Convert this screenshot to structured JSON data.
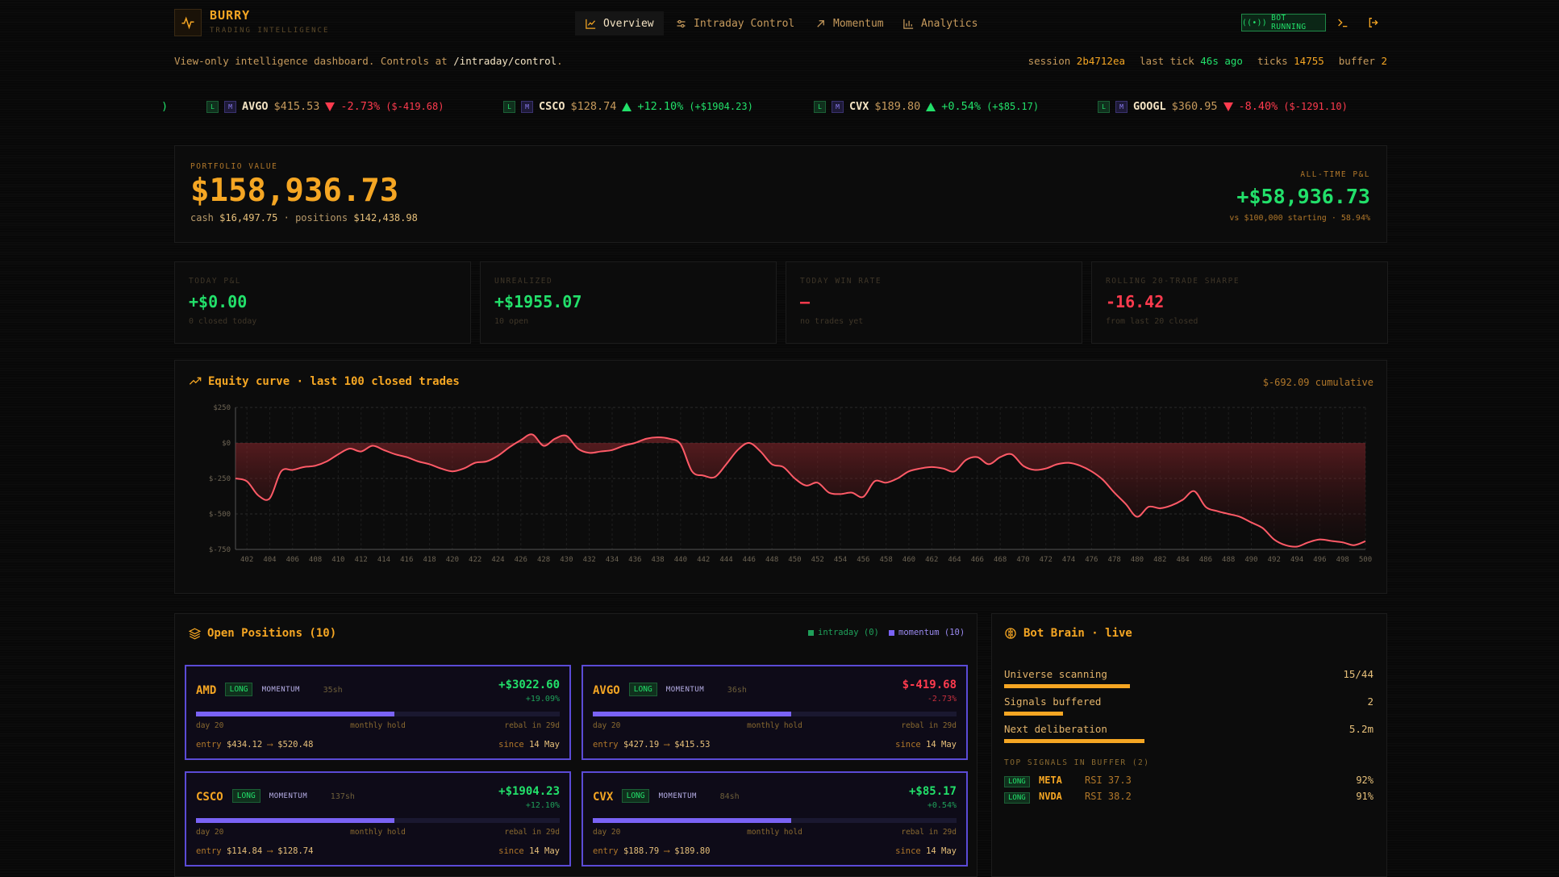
{
  "brand": {
    "name": "BURRY",
    "subtitle": "TRADING INTELLIGENCE"
  },
  "nav": {
    "overview": "Overview",
    "intraday": "Intraday Control",
    "momentum": "Momentum",
    "analytics": "Analytics",
    "active": "Overview"
  },
  "status": {
    "bot": "BOT RUNNING"
  },
  "subline": {
    "prefix": "View-only intelligence dashboard. Controls at ",
    "link": "/intraday/control",
    "suffix": "."
  },
  "session": {
    "session_label": "session",
    "session_value": "2b4712ea",
    "tick_label": "last tick",
    "tick_value": "46s ago",
    "ticks_label": "ticks",
    "ticks_value": "14755",
    "buffer_label": "buffer",
    "buffer_value": "2"
  },
  "ticker": [
    {
      "sym": "AVGO",
      "price": "$415.53",
      "dir": "down",
      "pct": "-2.73%",
      "abs": "($-419.68)"
    },
    {
      "sym": "CSCO",
      "price": "$128.74",
      "dir": "up",
      "pct": "+12.10%",
      "abs": "(+$1904.23)"
    },
    {
      "sym": "CVX",
      "price": "$189.80",
      "dir": "up",
      "pct": "+0.54%",
      "abs": "(+$85.17)"
    },
    {
      "sym": "GOOGL",
      "price": "$360.95",
      "dir": "down",
      "pct": "-8.40%",
      "abs": "($-1291.10)"
    }
  ],
  "ticker_chips": {
    "l": "L",
    "m": "M",
    "leading": ")"
  },
  "portfolio": {
    "label": "PORTFOLIO VALUE",
    "value": "$158,936.73",
    "cash_label": "cash",
    "cash": "$16,497.75",
    "positions_label": "· positions",
    "positions": "$142,438.98",
    "atl_label": "ALL-TIME P&L",
    "atl_value": "+$58,936.73",
    "atl_sub": "vs $100,000 starting · 58.94%"
  },
  "stats": [
    {
      "label": "TODAY P&L",
      "value": "+$0.00",
      "sub": "0 closed today",
      "color": "#22e06a"
    },
    {
      "label": "UNREALIZED",
      "value": "+$1955.07",
      "sub": "10 open",
      "color": "#22e06a"
    },
    {
      "label": "TODAY WIN RATE",
      "value": "—",
      "sub": "no trades yet",
      "color": "#ff3b4e"
    },
    {
      "label": "ROLLING 20-TRADE SHARPE",
      "value": "-16.42",
      "sub": "from last 20 closed",
      "color": "#ff3b4e"
    }
  ],
  "equity": {
    "title": "Equity curve · last 100 closed trades",
    "cumulative": "$-692.09 cumulative"
  },
  "chart_data": {
    "type": "area",
    "title": "Equity curve · last 100 closed trades",
    "xlabel": "",
    "ylabel": "",
    "ylim": [
      -750,
      250
    ],
    "yticks": [
      "$250",
      "$0",
      "$-250",
      "$-500",
      "$-750"
    ],
    "ytick_values": [
      250,
      0,
      -250,
      -500,
      -750
    ],
    "xlim": [
      401,
      500
    ],
    "xticks": [
      402,
      404,
      406,
      408,
      410,
      412,
      414,
      416,
      418,
      420,
      422,
      424,
      426,
      428,
      430,
      432,
      434,
      436,
      438,
      440,
      442,
      444,
      446,
      448,
      450,
      452,
      454,
      456,
      458,
      460,
      462,
      464,
      466,
      468,
      470,
      472,
      474,
      476,
      478,
      480,
      482,
      484,
      486,
      488,
      490,
      492,
      494,
      496,
      498,
      500
    ],
    "grid": true,
    "series": [
      {
        "x": [
          401,
          402,
          403,
          404,
          405,
          406,
          407,
          408,
          409,
          410,
          411,
          412,
          413,
          414,
          415,
          416,
          417,
          418,
          419,
          420,
          421,
          422,
          423,
          424,
          425,
          426,
          427,
          428,
          429,
          430,
          431,
          432,
          433,
          434,
          435,
          436,
          437,
          438,
          439,
          440,
          441,
          442,
          443,
          444,
          445,
          446,
          447,
          448,
          449,
          450,
          451,
          452,
          453,
          454,
          455,
          456,
          457,
          458,
          459,
          460,
          461,
          462,
          463,
          464,
          465,
          466,
          467,
          468,
          469,
          470,
          471,
          472,
          473,
          474,
          475,
          476,
          477,
          478,
          479,
          480,
          481,
          482,
          483,
          484,
          485,
          486,
          487,
          488,
          489,
          490,
          491,
          492,
          493,
          494,
          495,
          496,
          497,
          498,
          499,
          500
        ],
        "values": [
          -250,
          -270,
          -370,
          -390,
          -200,
          -190,
          -170,
          -160,
          -130,
          -80,
          -40,
          -60,
          -20,
          -50,
          -80,
          -100,
          -130,
          -150,
          -180,
          -200,
          -180,
          -140,
          -130,
          -90,
          -30,
          20,
          60,
          -20,
          30,
          50,
          -40,
          -70,
          -60,
          -50,
          -20,
          0,
          30,
          40,
          30,
          -10,
          -200,
          -230,
          -240,
          -150,
          -50,
          0,
          -60,
          -150,
          -170,
          -250,
          -300,
          -280,
          -350,
          -360,
          -350,
          -380,
          -270,
          -280,
          -250,
          -200,
          -180,
          -170,
          -180,
          -200,
          -120,
          -100,
          -150,
          -100,
          -80,
          -160,
          -190,
          -180,
          -150,
          -140,
          -160,
          -200,
          -260,
          -350,
          -430,
          -520,
          -450,
          -460,
          -440,
          -400,
          -340,
          -450,
          -480,
          -500,
          -520,
          -560,
          -600,
          -680,
          -720,
          -730,
          -700,
          -680,
          -690,
          -700,
          -720,
          -692
        ]
      }
    ]
  },
  "positions": {
    "title": "Open Positions (10)",
    "legend_intraday": "intraday (0)",
    "legend_momentum": "momentum (10)",
    "items": [
      {
        "sym": "AMD",
        "side": "LONG",
        "strategy": "MOMENTUM",
        "shares": "35sh",
        "pnl": "+$3022.60",
        "pct": "+19.09%",
        "positive": true,
        "fill": 0.546,
        "day": "day 20",
        "hold": "monthly hold",
        "rebal": "rebal in 29d",
        "entry_label": "entry",
        "entry": "$434.12",
        "arrow": "⟶",
        "current": "$520.48",
        "since_label": "since",
        "since": "14 May"
      },
      {
        "sym": "AVGO",
        "side": "LONG",
        "strategy": "MOMENTUM",
        "shares": "36sh",
        "pnl": "$-419.68",
        "pct": "-2.73%",
        "positive": false,
        "fill": 0.546,
        "day": "day 20",
        "hold": "monthly hold",
        "rebal": "rebal in 29d",
        "entry_label": "entry",
        "entry": "$427.19",
        "arrow": "⟶",
        "current": "$415.53",
        "since_label": "since",
        "since": "14 May"
      },
      {
        "sym": "CSCO",
        "side": "LONG",
        "strategy": "MOMENTUM",
        "shares": "137sh",
        "pnl": "+$1904.23",
        "pct": "+12.10%",
        "positive": true,
        "fill": 0.546,
        "day": "day 20",
        "hold": "monthly hold",
        "rebal": "rebal in 29d",
        "entry_label": "entry",
        "entry": "$114.84",
        "arrow": "⟶",
        "current": "$128.74",
        "since_label": "since",
        "since": "14 May"
      },
      {
        "sym": "CVX",
        "side": "LONG",
        "strategy": "MOMENTUM",
        "shares": "84sh",
        "pnl": "+$85.17",
        "pct": "+0.54%",
        "positive": true,
        "fill": 0.546,
        "day": "day 20",
        "hold": "monthly hold",
        "rebal": "rebal in 29d",
        "entry_label": "entry",
        "entry": "$188.79",
        "arrow": "⟶",
        "current": "$189.80",
        "since_label": "since",
        "since": "14 May"
      }
    ]
  },
  "brain": {
    "title": "Bot Brain · live",
    "rows": [
      {
        "label": "Universe scanning",
        "value": "15/44",
        "fraction": 0.34
      },
      {
        "label": "Signals buffered",
        "value": "2",
        "fraction": 0.16
      },
      {
        "label": "Next deliberation",
        "value": "5.2m",
        "fraction": 0.38
      }
    ],
    "signals_label": "TOP SIGNALS IN BUFFER (2)",
    "signals": [
      {
        "side": "LONG",
        "sym": "META",
        "rsi": "RSI 37.3",
        "conf": "92%"
      },
      {
        "side": "LONG",
        "sym": "NVDA",
        "rsi": "RSI 38.2",
        "conf": "91%"
      }
    ]
  },
  "colors": {
    "accent": "#f5a623",
    "positive": "#22e06a",
    "negative": "#ff3b4e",
    "momentum": "#7a63f5"
  }
}
